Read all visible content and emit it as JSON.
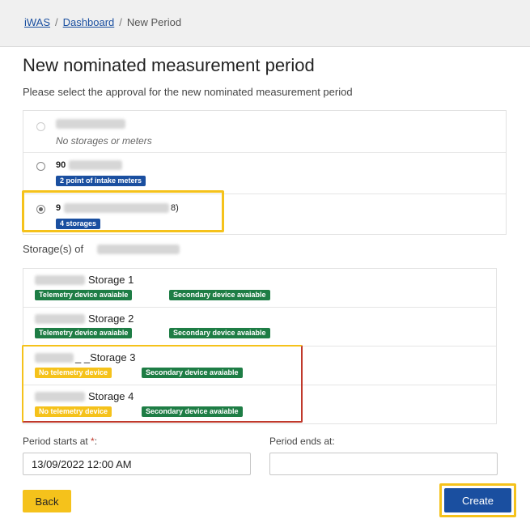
{
  "breadcrumb": {
    "root": "iWAS",
    "sep1": "/",
    "dashboard": "Dashboard",
    "sep2": "/",
    "current": "New Period"
  },
  "page": {
    "title": "New nominated measurement period",
    "subtitle": "Please select the approval for the new nominated measurement period"
  },
  "approvals": [
    {
      "selected": false,
      "disabled": true,
      "label": "",
      "note": "No storages or meters"
    },
    {
      "selected": false,
      "disabled": false,
      "label": "90",
      "tag": "2 point of intake meters"
    },
    {
      "selected": true,
      "disabled": false,
      "label_start": "9",
      "label_end": "8)",
      "tag": "4 storages"
    }
  ],
  "storage_heading": "Storage(s) of",
  "storages": [
    {
      "name": "Storage 1",
      "telemetry": "Telemetry device avaiable",
      "secondary": "Secondary device avaiable"
    },
    {
      "name": "Storage 2",
      "telemetry": "Telemetry device avaiable",
      "secondary": "Secondary device avaiable"
    },
    {
      "name": "_ _Storage 3",
      "telemetry": "No telemetry device",
      "secondary": "Secondary device avaiable"
    },
    {
      "name": "Storage 4",
      "telemetry": "No telemetry device",
      "secondary": "Secondary device avaiable"
    }
  ],
  "form": {
    "start_label": "Period starts at",
    "required_mark": "*",
    "colon": ":",
    "start_value": "13/09/2022 12:00 AM",
    "end_label": "Period ends at:",
    "end_value": ""
  },
  "buttons": {
    "back": "Back",
    "create": "Create"
  },
  "colors": {
    "primary": "#1a4fa0",
    "success": "#1e7d45",
    "warning": "#f5c21b",
    "highlight": "#f5c21b"
  }
}
